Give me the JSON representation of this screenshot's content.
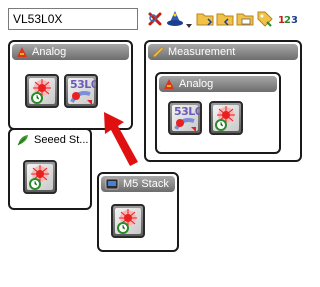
{
  "search": {
    "value": "VL53L0X"
  },
  "toolbar": {
    "icons": [
      "clear-search-icon",
      "wizard-icon",
      "dropdown-arrow-icon",
      "expand-folder-icon",
      "collapse-folder-icon",
      "open-folder-icon",
      "tag-icon",
      "number-icon"
    ]
  },
  "panels": {
    "analog": {
      "title": "Analog"
    },
    "measurement": {
      "title": "Measurement"
    },
    "measurement_analog": {
      "title": "Analog"
    },
    "seeed": {
      "title": "Seeed St..."
    },
    "m5stack": {
      "title": "M5 Stack"
    }
  },
  "block_text": "53L0",
  "colors": {
    "arrow": "#e01010",
    "header_dark": "#7a7a7a"
  }
}
